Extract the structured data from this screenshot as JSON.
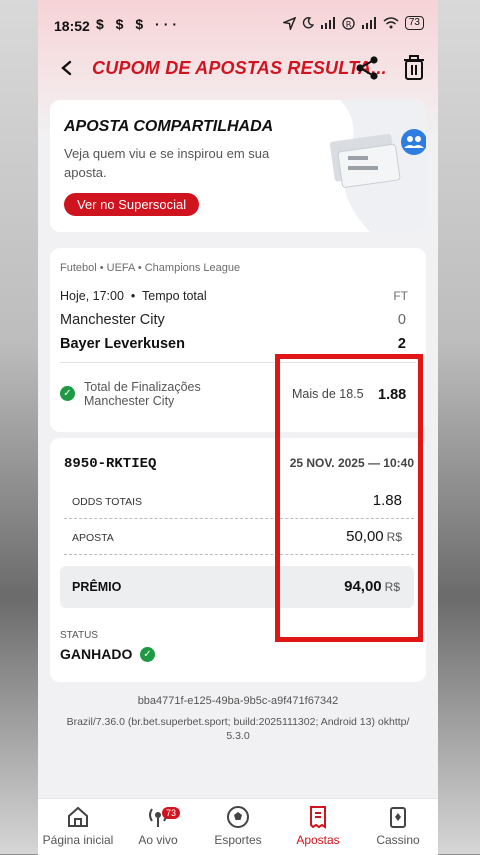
{
  "status_bar": {
    "time": "18:52",
    "left_icons": "$ $ $ ···",
    "battery": "73"
  },
  "header": {
    "title": "CUPOM DE APOSTAS RESULTA..."
  },
  "promo": {
    "heading": "APOSTA COMPARTILHADA",
    "description": "Veja quem viu e se inspirou em sua aposta.",
    "button": "Ver no Supersocial"
  },
  "bet": {
    "breadcrumb": "Futebol • UEFA • Champions League",
    "time": "Hoje, 17:00",
    "period": "Tempo total",
    "status": "FT",
    "team1": "Manchester City",
    "score1": "0",
    "team2": "Bayer Leverkusen",
    "score2": "2",
    "market": "Total de Finalizações",
    "market_team": "Manchester City",
    "selection": "Mais de 18.5",
    "odd": "1.88"
  },
  "coupon": {
    "id": "8950-RKTIEQ",
    "date": "25 NOV. 2025 — 10:40",
    "odds_label": "ODDS TOTAIS",
    "odds_value": "1.88",
    "stake_label": "APOSTA",
    "stake_value": "50,00",
    "currency": "R$",
    "prize_label": "PRÊMIO",
    "prize_value": "94,00",
    "status_label": "STATUS",
    "status_value": "GANHADO"
  },
  "footer": {
    "hash": "bba4771f-e125-49ba-9b5c-a9f471f67342",
    "build": "Brazil/7.36.0 (br.bet.superbet.sport; build:2025111302; Android 13) okhttp/ 5.3.0"
  },
  "nav": {
    "items": [
      "Página inicial",
      "Ao vivo",
      "Esportes",
      "Apostas",
      "Cassino"
    ],
    "live_badge": "73",
    "active": "Apostas"
  },
  "colors": {
    "brand": "#d0141f",
    "success": "#1f9a44",
    "highlight": "#e01515"
  },
  "icons": [
    "back-arrow-icon",
    "share-icon",
    "trash-icon",
    "check-icon",
    "home-icon",
    "live-icon",
    "football-icon",
    "receipt-icon",
    "cards-icon"
  ]
}
